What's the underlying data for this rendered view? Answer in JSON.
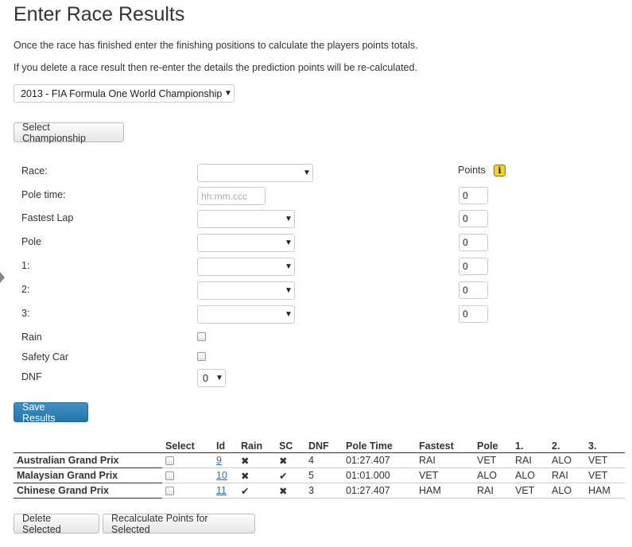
{
  "title": "Enter Race Results",
  "intro": {
    "line1": "Once the race has finished enter the finishing positions to calculate the players points totals.",
    "line2": "If you delete a race result then re-enter the details the prediction points will be re-calculated."
  },
  "championship_select": {
    "value": "2013 - FIA Formula One World Championship"
  },
  "select_championship_label": "Select Championship",
  "form": {
    "race_label": "Race:",
    "race_value": "",
    "points_header": "Points",
    "pole_time_label": "Pole time:",
    "pole_time_placeholder": "hh:mm.ccc",
    "fastest_lap_label": "Fastest Lap",
    "pole_label": "Pole",
    "first_label": "1:",
    "second_label": "2:",
    "third_label": "3:",
    "rain_label": "Rain",
    "safety_car_label": "Safety Car",
    "dnf_label": "DNF",
    "dnf_value": "0",
    "points": [
      "0",
      "0",
      "0",
      "0",
      "0",
      "0"
    ]
  },
  "save_label": "Save Results",
  "table": {
    "headers": [
      "",
      "Select",
      "Id",
      "Rain",
      "SC",
      "DNF",
      "Pole Time",
      "Fastest",
      "Pole",
      "1.",
      "2.",
      "3."
    ],
    "rows": [
      {
        "name": "Australian Grand Prix",
        "id": "9",
        "rain": "✖",
        "sc": "✖",
        "dnf": "4",
        "pole_time": "01:27.407",
        "fastest": "RAI",
        "pole": "VET",
        "p1": "RAI",
        "p2": "ALO",
        "p3": "VET"
      },
      {
        "name": "Malaysian Grand Prix",
        "id": "10",
        "rain": "✖",
        "sc": "✔",
        "dnf": "5",
        "pole_time": "01:01.000",
        "fastest": "VET",
        "pole": "ALO",
        "p1": "ALO",
        "p2": "RAI",
        "p3": "VET"
      },
      {
        "name": "Chinese Grand Prix",
        "id": "11",
        "rain": "✔",
        "sc": "✖",
        "dnf": "3",
        "pole_time": "01:27.407",
        "fastest": "HAM",
        "pole": "RAI",
        "p1": "VET",
        "p2": "ALO",
        "p3": "HAM"
      }
    ]
  },
  "delete_label": "Delete Selected",
  "recalc_label": "Recalculate Points for Selected"
}
